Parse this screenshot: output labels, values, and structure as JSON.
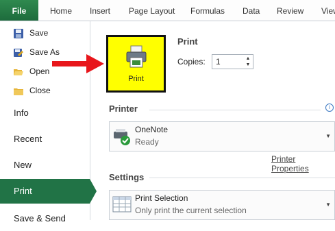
{
  "ribbon": {
    "tabs": [
      "File",
      "Home",
      "Insert",
      "Page Layout",
      "Formulas",
      "Data",
      "Review",
      "View"
    ]
  },
  "nav": {
    "commands": [
      {
        "label": "Save",
        "icon": "save-icon"
      },
      {
        "label": "Save As",
        "icon": "save-as-icon"
      },
      {
        "label": "Open",
        "icon": "folder-open-icon"
      },
      {
        "label": "Close",
        "icon": "folder-close-icon"
      }
    ],
    "items": [
      "Info",
      "Recent",
      "New",
      "Print",
      "Save & Send"
    ],
    "active": "Print"
  },
  "print": {
    "button_label": "Print",
    "section_title": "Print",
    "copies_label": "Copies:",
    "copies_value": "1"
  },
  "printer": {
    "section_title": "Printer",
    "name": "OneNote",
    "status": "Ready",
    "properties_link": "Printer Properties"
  },
  "settings": {
    "section_title": "Settings",
    "option_title": "Print Selection",
    "option_desc": "Only print the current selection"
  },
  "colors": {
    "file_tab": "#217346",
    "highlight": "#ffff00",
    "arrow": "#e8161b"
  }
}
